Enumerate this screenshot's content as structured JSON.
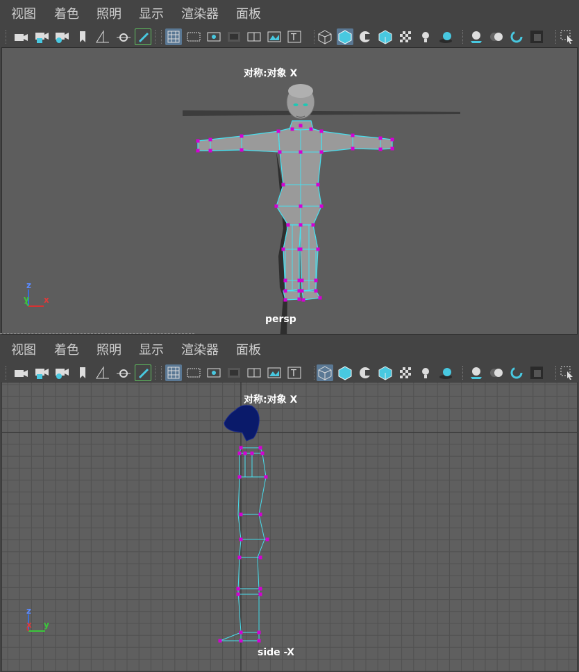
{
  "menus": [
    "视图",
    "着色",
    "照明",
    "显示",
    "渲染器",
    "面板"
  ],
  "top_viewport": {
    "symmetry_label": "对称:对象 X",
    "camera_name": "persp",
    "axes": {
      "z": "z",
      "y": "y",
      "x": "x"
    }
  },
  "bottom_viewport": {
    "symmetry_label": "对称:对象 X",
    "camera_name": "side -X",
    "axes": {
      "z": "z",
      "x": "x",
      "y": "y"
    }
  },
  "toolbar_icons": [
    "camera-icon",
    "camera-lock-icon",
    "camera-settings-icon",
    "bookmark-icon",
    "grid-plane-icon",
    "transform-pivot-icon",
    "pencil-icon",
    "grid-toggle-icon",
    "film-gate-icon",
    "resolution-gate-icon",
    "gate-mask-icon",
    "field-chart-icon",
    "image-plane-icon",
    "text-icon",
    "wireframe-icon",
    "smooth-shade-icon",
    "default-material-icon",
    "shaded-wireframe-icon",
    "textured-icon",
    "use-all-lights-icon",
    "shadows-icon",
    "screen-space-ao-icon",
    "motion-blur-icon",
    "antialias-icon",
    "isolate-select-icon",
    "xray-icon"
  ],
  "colors": {
    "cage": "#48dfef",
    "vertex": "#d400d4",
    "head_bot": "#0a1a6a"
  }
}
